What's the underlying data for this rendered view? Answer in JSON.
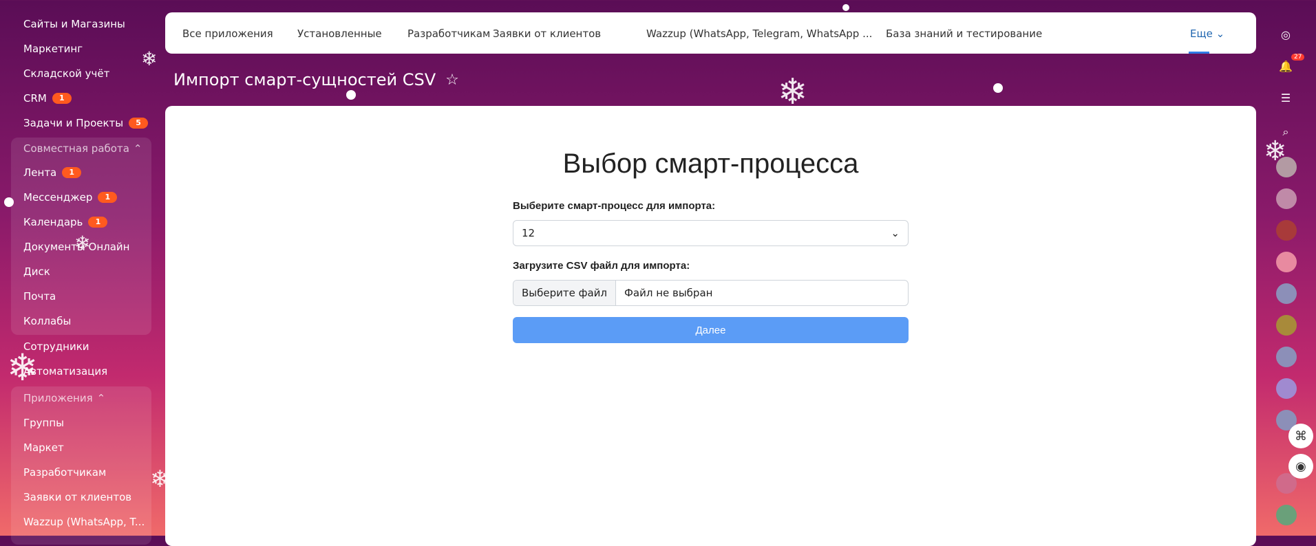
{
  "sidebar": {
    "items": [
      {
        "label": "Сайты и Магазины",
        "badge": ""
      },
      {
        "label": "Маркетинг",
        "badge": ""
      },
      {
        "label": "Складской учёт",
        "badge": ""
      },
      {
        "label": "CRM",
        "badge": "1"
      },
      {
        "label": "Задачи и Проекты",
        "badge": "5"
      }
    ],
    "group1_title": "Совместная работа",
    "group1_items": [
      {
        "label": "Лента",
        "badge": "1"
      },
      {
        "label": "Мессенджер",
        "badge": "1"
      },
      {
        "label": "Календарь",
        "badge": "1"
      },
      {
        "label": "Документы Онлайн",
        "badge": ""
      },
      {
        "label": "Диск",
        "badge": ""
      },
      {
        "label": "Почта",
        "badge": ""
      },
      {
        "label": "Коллабы",
        "badge": ""
      }
    ],
    "mid_items": [
      {
        "label": "Сотрудники"
      },
      {
        "label": "Автоматизация"
      }
    ],
    "group2_title": "Приложения",
    "group2_items": [
      {
        "label": "Группы"
      },
      {
        "label": "Маркет"
      },
      {
        "label": "Разработчикам"
      },
      {
        "label": "Заявки от клиентов"
      },
      {
        "label": "Wazzup (WhatsApp, T..."
      }
    ]
  },
  "tabs": [
    {
      "label": "Все приложения"
    },
    {
      "label": "Установленные"
    },
    {
      "label": "Разработчикам"
    },
    {
      "label": "Заявки от клиентов"
    },
    {
      "label": "Wazzup (WhatsApp, Telegram, WhatsApp ..."
    },
    {
      "label": "База знаний и тестирование"
    }
  ],
  "tabs_more": "Еще",
  "page_title": "Импорт смарт-сущностей CSV",
  "form": {
    "heading": "Выбор смарт-процесса",
    "select_label": "Выберите смарт-процесс для импорта:",
    "select_value": "12",
    "file_label": "Загрузите CSV файл для импорта:",
    "file_button": "Выберите файл",
    "file_status": "Файл не выбран",
    "submit_label": "Далее"
  },
  "rail": {
    "notifications_count": "27"
  },
  "colors": {
    "accent": "#2f7be5",
    "button": "#5b9cf6",
    "badge": "#ff5a1f"
  }
}
